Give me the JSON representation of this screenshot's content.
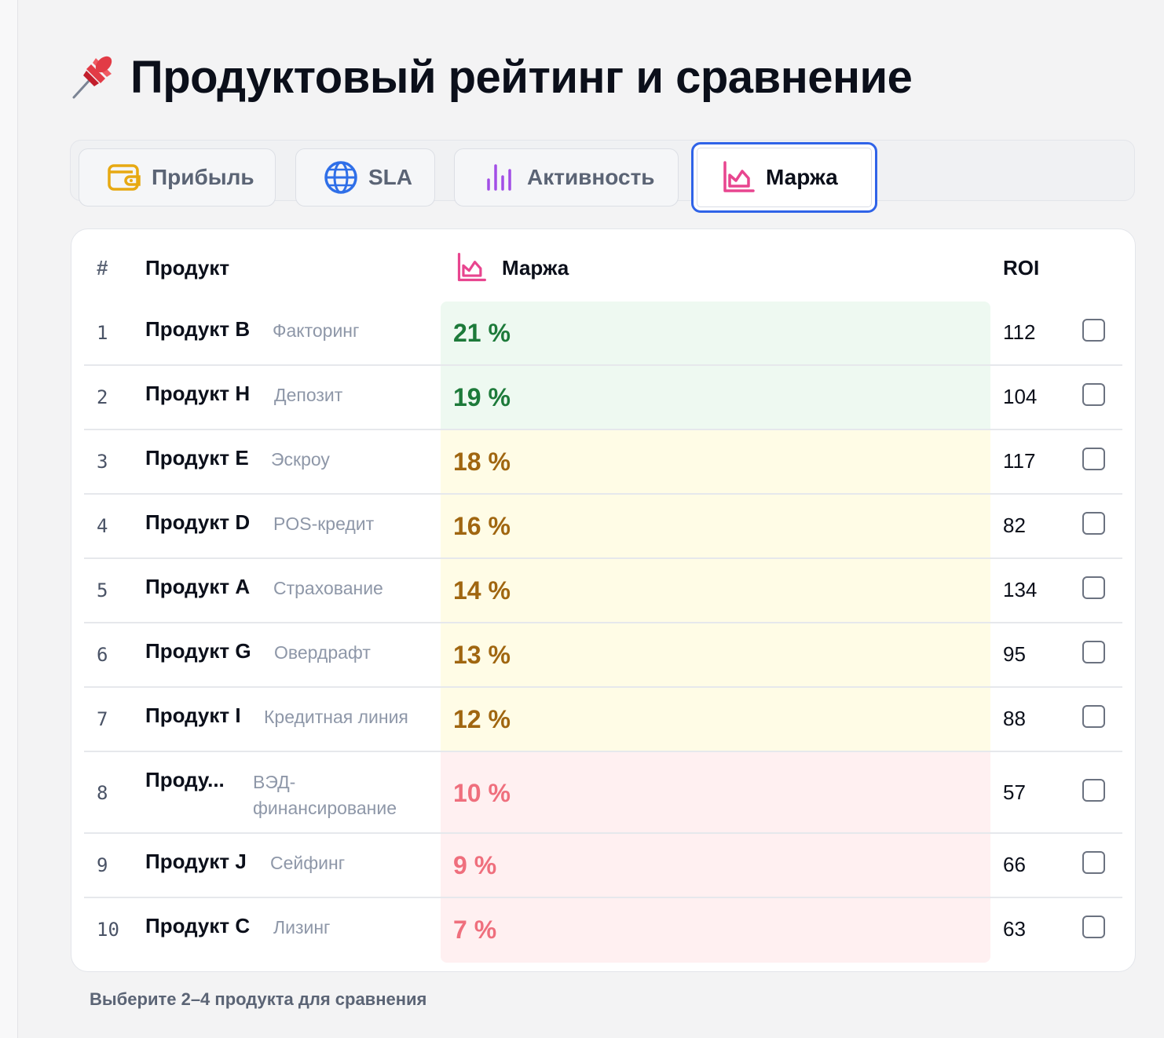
{
  "page": {
    "title": "Продуктовый рейтинг и сравнение",
    "title_icon": "pushpin-icon",
    "hint": "Выберите 2–4 продукта для сравнения"
  },
  "tabs": [
    {
      "label": "Прибыль",
      "icon": "wallet-icon",
      "active": false
    },
    {
      "label": "SLA",
      "icon": "globe-icon",
      "active": false
    },
    {
      "label": "Активность",
      "icon": "bar-chart-icon",
      "active": false
    },
    {
      "label": "Маржа",
      "icon": "area-chart-icon",
      "active": true
    }
  ],
  "table": {
    "headers": {
      "rank": "#",
      "product": "Продукт",
      "metric": "Маржа",
      "roi": "ROI"
    },
    "rows": [
      {
        "rank": "1",
        "name": "Продукт B",
        "type": "Факторинг",
        "metric": "21 %",
        "roi": "112",
        "tier": "green"
      },
      {
        "rank": "2",
        "name": "Продукт H",
        "type": "Депозит",
        "metric": "19 %",
        "roi": "104",
        "tier": "green"
      },
      {
        "rank": "3",
        "name": "Продукт E",
        "type": "Эскроу",
        "metric": "18 %",
        "roi": "117",
        "tier": "yellow"
      },
      {
        "rank": "4",
        "name": "Продукт D",
        "type": "POS-кредит",
        "metric": "16 %",
        "roi": "82",
        "tier": "yellow"
      },
      {
        "rank": "5",
        "name": "Продукт A",
        "type": "Страхование",
        "metric": "14 %",
        "roi": "134",
        "tier": "yellow"
      },
      {
        "rank": "6",
        "name": "Продукт G",
        "type": "Овердрафт",
        "metric": "13 %",
        "roi": "95",
        "tier": "yellow"
      },
      {
        "rank": "7",
        "name": "Продукт I",
        "type": "Кредитная линия",
        "metric": "12 %",
        "roi": "88",
        "tier": "yellow"
      },
      {
        "rank": "8",
        "name": "Проду...",
        "type": "ВЭД-финансирование",
        "metric": "10 %",
        "roi": "57",
        "tier": "red"
      },
      {
        "rank": "9",
        "name": "Продукт J",
        "type": "Сейфинг",
        "metric": "9 %",
        "roi": "66",
        "tier": "red"
      },
      {
        "rank": "10",
        "name": "Продукт C",
        "type": "Лизинг",
        "metric": "7 %",
        "roi": "63",
        "tier": "red"
      }
    ]
  },
  "colors": {
    "accent": "#2f63e8",
    "margin_icon": "#e8458f",
    "good": "#1d7a3a",
    "mid": "#a06610",
    "bad": "#ef6f7d"
  }
}
